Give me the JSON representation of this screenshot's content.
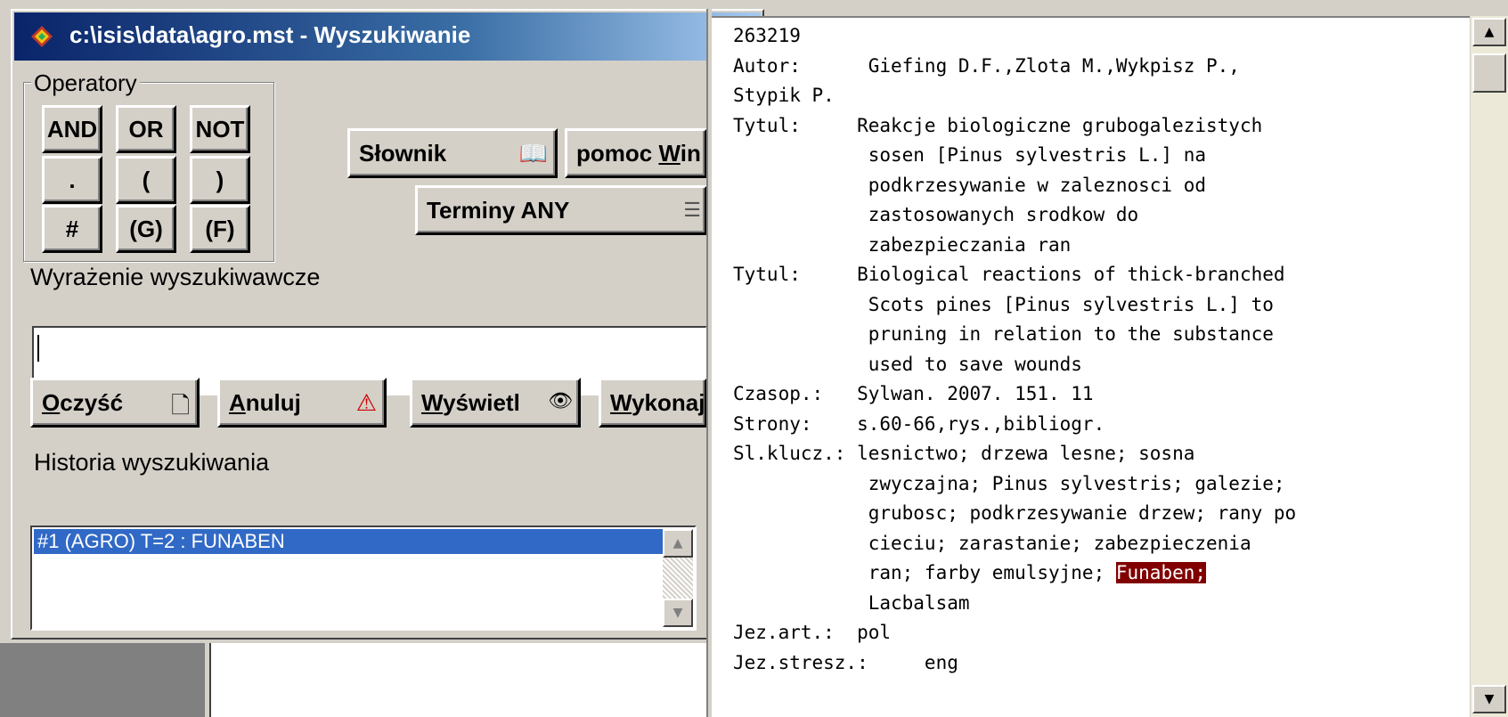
{
  "window": {
    "title": "c:\\isis\\data\\agro.mst - Wyszukiwanie",
    "close_label": "×"
  },
  "operators": {
    "legend": "Operatory",
    "buttons": [
      "AND",
      "OR",
      "NOT",
      ".",
      "(",
      ")",
      "#",
      "(G)",
      "(F)"
    ]
  },
  "toolbar": {
    "dictionary": "Słownik",
    "help_prefix": "pomoc ",
    "help_u": "W",
    "help_rest": "in",
    "terms_any": "Terminy ANY"
  },
  "expression": {
    "label": "Wyrażenie wyszukiwawcze",
    "value": ""
  },
  "actions": {
    "clear_u": "O",
    "clear_rest": "czyść",
    "cancel_u": "A",
    "cancel_rest": "nuluj",
    "display_u": "W",
    "display_rest": "yświetl",
    "execute_u": "W",
    "execute_rest": "ykonaj"
  },
  "history": {
    "label": "Historia wyszukiwania",
    "items": [
      "#1 (AGRO) T=2 : FUNABEN"
    ]
  },
  "record": {
    "lines": [
      "263219",
      "Autor:      Giefing D.F.,Zlota M.,Wykpisz P.,",
      "Stypik P.",
      "Tytul:     Reakcje biologiczne grubogalezistych",
      "            sosen [Pinus sylvestris L.] na",
      "            podkrzesywanie w zaleznosci od",
      "            zastosowanych srodkow do",
      "            zabezpieczania ran",
      "Tytul:     Biological reactions of thick-branched",
      "            Scots pines [Pinus sylvestris L.] to",
      "            pruning in relation to the substance",
      "            used to save wounds",
      "Czasop.:   Sylwan. 2007. 151. 11",
      "Strony:    s.60-66,rys.,bibliogr.",
      "Sl.klucz.: lesnictwo; drzewa lesne; sosna",
      "            zwyczajna; Pinus sylvestris; galezie;",
      "            grubosc; podkrzesywanie drzew; rany po",
      "            cieciu; zarastanie; zabezpieczenia",
      "            ran; farby emulsyjne; ",
      "            Lacbalsam",
      "Jez.art.:  pol",
      "Jez.stresz.:     eng"
    ],
    "highlight": "Funaben;"
  }
}
